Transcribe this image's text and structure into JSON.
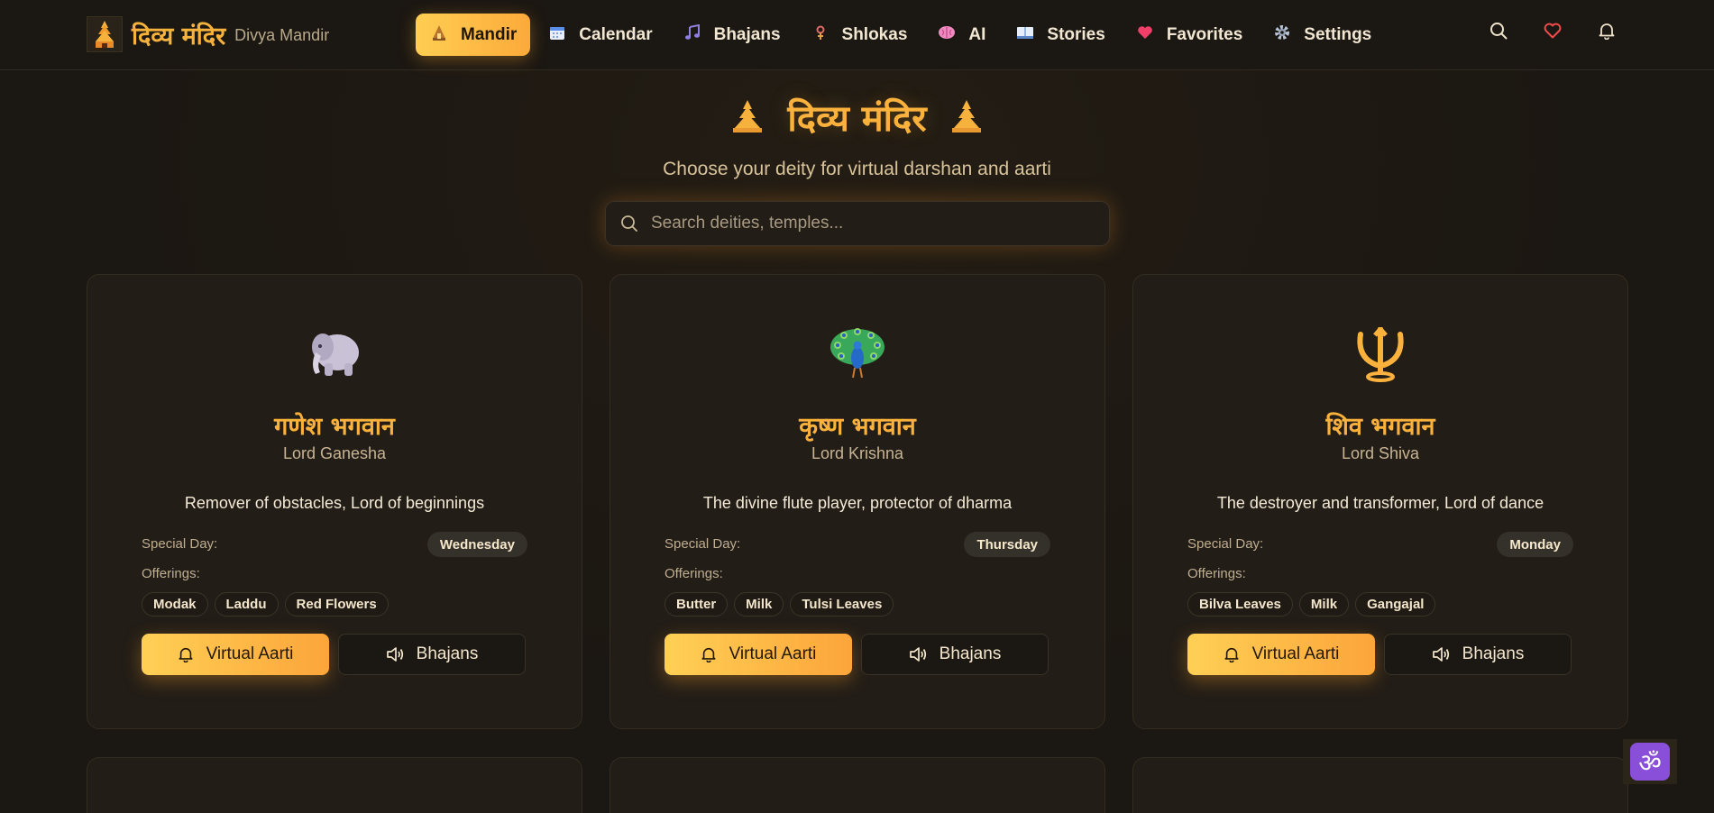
{
  "brand": {
    "hindi": "दिव्य मंदिर",
    "english": "Divya Mandir"
  },
  "nav": [
    {
      "label": "Mandir",
      "icon": "temple-icon",
      "active": true
    },
    {
      "label": "Calendar",
      "icon": "calendar-icon"
    },
    {
      "label": "Bhajans",
      "icon": "music-note-icon"
    },
    {
      "label": "Shlokas",
      "icon": "lotus-icon"
    },
    {
      "label": "AI",
      "icon": "brain-icon"
    },
    {
      "label": "Stories",
      "icon": "book-icon"
    },
    {
      "label": "Favorites",
      "icon": "heart-icon"
    },
    {
      "label": "Settings",
      "icon": "gear-icon"
    }
  ],
  "header": {
    "title": "दिव्य मंदिर",
    "subtitle": "Choose your deity for virtual darshan and aarti"
  },
  "search": {
    "placeholder": "Search deities, temples..."
  },
  "labels": {
    "special_day": "Special Day:",
    "offerings": "Offerings:",
    "aarti_button": "Virtual Aarti",
    "bhajan_button": "Bhajans"
  },
  "deities": [
    {
      "hindi": "गणेश भगवान",
      "english": "Lord Ganesha",
      "icon": "elephant-icon",
      "description": "Remover of obstacles, Lord of beginnings",
      "special_day": "Wednesday",
      "offerings": [
        "Modak",
        "Laddu",
        "Red Flowers"
      ]
    },
    {
      "hindi": "कृष्ण भगवान",
      "english": "Lord Krishna",
      "icon": "peacock-icon",
      "description": "The divine flute player, protector of dharma",
      "special_day": "Thursday",
      "offerings": [
        "Butter",
        "Milk",
        "Tulsi Leaves"
      ]
    },
    {
      "hindi": "शिव भगवान",
      "english": "Lord Shiva",
      "icon": "trident-icon",
      "description": "The destroyer and transformer, Lord of dance",
      "special_day": "Monday",
      "offerings": [
        "Bilva Leaves",
        "Milk",
        "Gangajal"
      ]
    }
  ],
  "colors": {
    "accent": "#fbb23d",
    "background": "#1b1712",
    "card": "#221d17"
  }
}
